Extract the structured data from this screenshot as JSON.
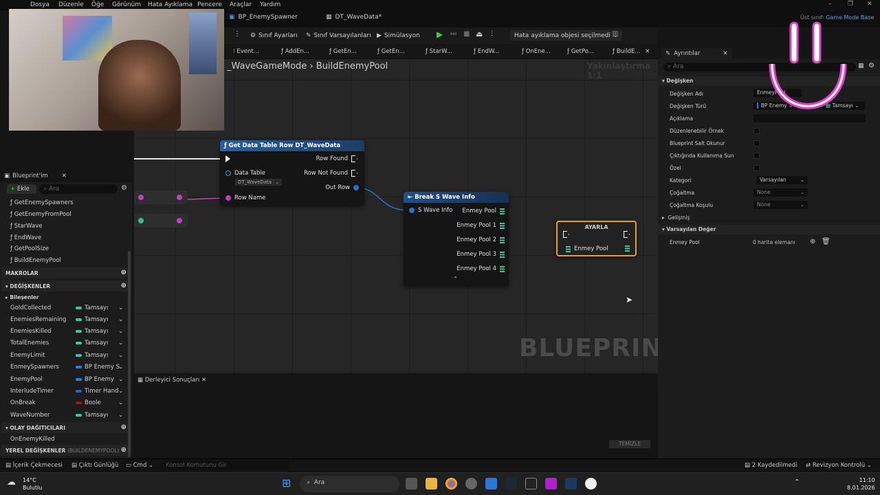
{
  "menu": [
    "Dosya",
    "Düzenle",
    "Öğe",
    "Görünüm",
    "Hata Ayıklama",
    "Pencere",
    "Araçlar",
    "Yardım"
  ],
  "doc_tabs": [
    "BP_EnemySpawner",
    "DT_WaveData*"
  ],
  "parent_class": {
    "label": "Üst sınıf:",
    "value": "Game Mode Base"
  },
  "toolbar": {
    "class_settings": "Sınıf Ayarları",
    "class_defaults": "Sınıf Varsayılanları",
    "simulation": "Simülasyon",
    "debug_object": "Hata ayıklama objesi seçilmedi"
  },
  "graph_tabs": [
    "Event...",
    "AddEn...",
    "GetEn...",
    "GetEn...",
    "StarW...",
    "EndW...",
    "OnEne...",
    "GetPo...",
    "BuildE..."
  ],
  "breadcrumb": {
    "parent": "_WaveGameMode",
    "current": "BuildEnemyPool"
  },
  "zoom": "Yakınlaştırma 1:1",
  "watermark": "BLUEPRINT",
  "nodes": {
    "get_row": {
      "title": "Get Data Table Row DT_WaveData",
      "data_table": "Data Table",
      "table_value": "DT_WaveData",
      "row_name": "Row Name",
      "row_found": "Row Found",
      "row_not_found": "Row Not Found",
      "out_row": "Out Row"
    },
    "break": {
      "title": "Break S Wave Info",
      "in": "S Wave Info",
      "outs": [
        "Enmey Pool",
        "Enmey Pool 1",
        "Enmey Pool 2",
        "Enmey Pool 3",
        "Enmey Pool 4"
      ]
    },
    "set": {
      "title": "AYARLA",
      "pin": "Enmey Pool"
    }
  },
  "left": {
    "tab": "Blueprint'im",
    "add": "Ekle",
    "search_placeholder": "Ara",
    "functions": [
      "GetEnemySpawners",
      "GetEnemyFromPool",
      "StarWave",
      "EndWave",
      "GetPoolSize",
      "BuildEnemyPool"
    ],
    "macros": "MAKROLAR",
    "variables": "DEĞİŞKENLER",
    "components": "Bileşenler",
    "vars": [
      {
        "name": "GoldCollected",
        "type": "Tamsayı",
        "color": "#3ec7a0"
      },
      {
        "name": "EnemiesRemaining",
        "type": "Tamsayı",
        "color": "#3ec7a0"
      },
      {
        "name": "EnemiesKilled",
        "type": "Tamsayı",
        "color": "#3ec7a0"
      },
      {
        "name": "TotalEnemies",
        "type": "Tamsayı",
        "color": "#3ec7a0"
      },
      {
        "name": "EnemyLimit",
        "type": "Tamsayı",
        "color": "#3ec7a0"
      },
      {
        "name": "EnmeySpawners",
        "type": "BP Enemy S",
        "color": "#2a7fd8"
      },
      {
        "name": "EnemyPool",
        "type": "BP Enemy",
        "color": "#2a7fd8"
      },
      {
        "name": "InterludeTimer",
        "type": "Timer Hand",
        "color": "#2a5fd8"
      },
      {
        "name": "OnBreak",
        "type": "Boole",
        "color": "#a01818"
      },
      {
        "name": "WaveNumber",
        "type": "Tamsayı",
        "color": "#3ec7a0"
      }
    ],
    "dispatchers": "OLAY DAĞITICILARI",
    "dispatcher_items": [
      "OnEnemyKilled"
    ],
    "locals": "YEREL DEĞİŞKENLER",
    "locals_scope": "(BUILDENEMYPOOL)"
  },
  "details": {
    "tab": "Ayrıntılar",
    "search_placeholder": "Ara",
    "section": "Değişken",
    "rows": [
      "Değişken Adı",
      "Değişken Türü",
      "Açıklama",
      "Düzenlenebilir Örnek",
      "Blueprint Salt Okunur",
      "Çıktığında Kullanıma Sun",
      "Özel",
      "Kategori",
      "Çoğaltma",
      "Çoğaltma Koşulu"
    ],
    "var_name": "EnmeyPool",
    "var_type": "BP Enemy",
    "var_type2": "Tamsayı",
    "category": "Varsayılan",
    "replication": "None",
    "replication_cond": "None",
    "advanced": "Gelişmiş",
    "default_section": "Varsayılan Değer",
    "default_label": "Enmey Pool",
    "default_value": "0 harita elemanı"
  },
  "bottom": {
    "tab": "Derleyici Sonuçları",
    "clear": "TEMİZLE"
  },
  "status": {
    "content": "İçerik Çekmecesi",
    "log": "Çıktı Günlüğü",
    "cmd": "Cmd",
    "console_placeholder": "Konsol Komutunu Gir",
    "saved": "2 Kaydedilmedi",
    "revision": "Revizyon Kontrolü"
  },
  "taskbar": {
    "temp": "14°C",
    "weather": "Bulutlu",
    "search": "Ara",
    "time": "11:10",
    "date": "8.01.2026"
  }
}
